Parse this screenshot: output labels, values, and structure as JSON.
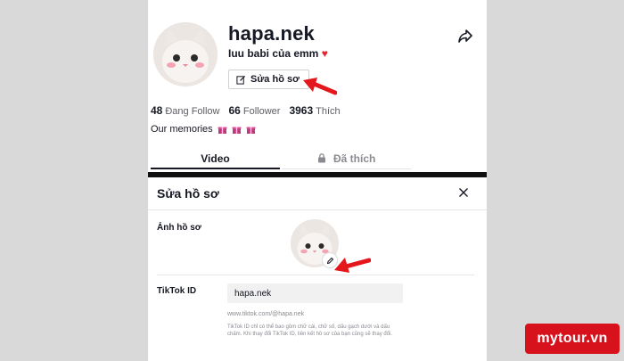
{
  "profile": {
    "username": "hapa.nek",
    "bio": "Iuu babi của emm",
    "bio_heart": "♥",
    "edit_button_label": "Sửa hồ sơ",
    "stats": [
      {
        "value": "48",
        "label": "Đang Follow"
      },
      {
        "value": "66",
        "label": "Follower"
      },
      {
        "value": "3963",
        "label": "Thích"
      }
    ],
    "memories_label": "Our memories",
    "tabs": [
      {
        "label": "Video"
      },
      {
        "label": "Đã thích"
      }
    ]
  },
  "edit_dialog": {
    "title": "Sửa hồ sơ",
    "photo_label": "Ảnh hồ sơ",
    "tiktok_id_label": "TikTok ID",
    "tiktok_id_value": "hapa.nek",
    "profile_url": "www.tiktok.com/@hapa.nek",
    "id_help": "TikTok ID chỉ có thể bao gồm chữ cái, chữ số, dấu gạch dưới và dấu chấm. Khi thay đổi TikTok ID, liên kết hồ sơ của bạn cũng sẽ thay đổi."
  },
  "brand": {
    "text": "mytour.vn"
  },
  "colors": {
    "accent": "#e0262f",
    "brand": "#d7121d",
    "arrow": "#e3171c"
  },
  "icons": [
    "share-icon",
    "edit-icon",
    "lock-icon",
    "close-icon",
    "pencil-icon",
    "gift-icon"
  ]
}
